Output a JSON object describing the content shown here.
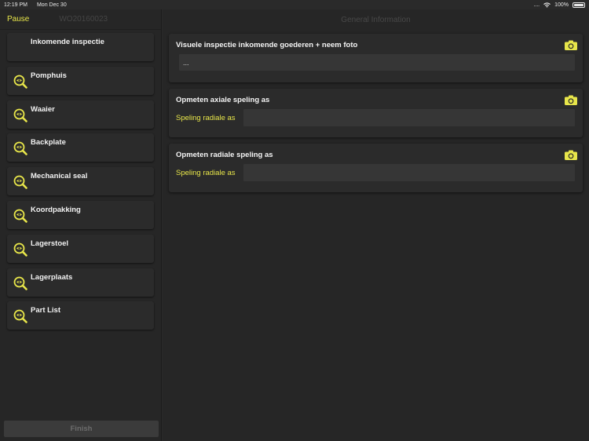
{
  "status_bar": {
    "time": "12:19 PM",
    "date": "Mon Dec 30",
    "signal": "....",
    "battery": "100%"
  },
  "sidebar": {
    "pause_label": "Pause",
    "work_order": "WO20160023",
    "items": [
      {
        "label": "Inkomende inspectie",
        "icon": "none"
      },
      {
        "label": "Pomphuis",
        "icon": "magnifier-eye-icon"
      },
      {
        "label": "Waaier",
        "icon": "magnifier-eye-icon"
      },
      {
        "label": "Backplate",
        "icon": "magnifier-eye-icon"
      },
      {
        "label": "Mechanical seal",
        "icon": "magnifier-eye-icon"
      },
      {
        "label": "Koordpakking",
        "icon": "magnifier-eye-icon"
      },
      {
        "label": "Lagerstoel",
        "icon": "magnifier-eye-icon"
      },
      {
        "label": "Lagerplaats",
        "icon": "magnifier-eye-icon"
      },
      {
        "label": "Part List",
        "icon": "magnifier-eye-icon"
      }
    ],
    "finish_label": "Finish"
  },
  "main": {
    "title": "General Information",
    "cards": [
      {
        "title": "Visuele inspectie inkomende goederen + neem foto",
        "field_label": "",
        "field_value": "..."
      },
      {
        "title": "Opmeten axiale speling as",
        "field_label": "Speling radiale as",
        "field_value": ""
      },
      {
        "title": "Opmeten radiale speling as",
        "field_label": "Speling radiale as",
        "field_value": ""
      }
    ]
  },
  "colors": {
    "accent": "#e8e64a",
    "background": "#262626",
    "card": "#2b2b2b",
    "field": "#363636"
  }
}
